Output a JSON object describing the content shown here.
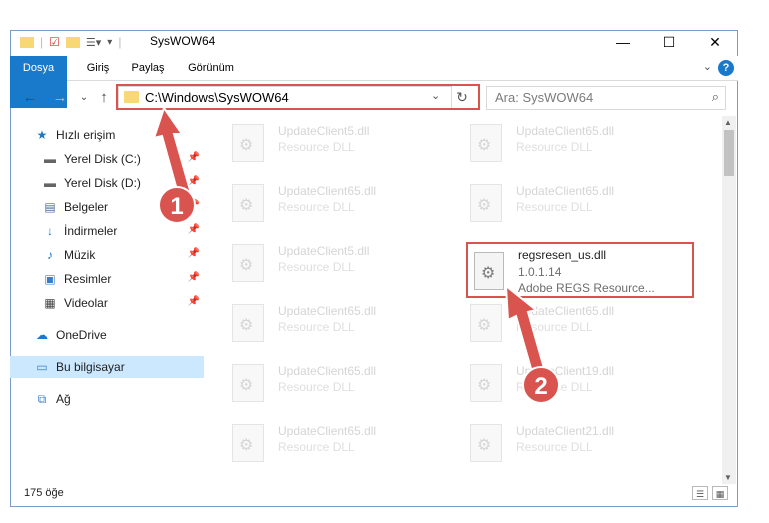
{
  "window": {
    "title": "SysWOW64",
    "controls": {
      "minimize": "—",
      "maximize": "☐",
      "close": "✕"
    }
  },
  "ribbon": {
    "tabs": [
      {
        "label": "Dosya",
        "active": true
      },
      {
        "label": "Giriş"
      },
      {
        "label": "Paylaş"
      },
      {
        "label": "Görünüm"
      }
    ],
    "help": "?"
  },
  "address": {
    "path": "C:\\Windows\\SysWOW64",
    "search_placeholder": "Ara: SysWOW64"
  },
  "sidebar": {
    "items": [
      {
        "label": "Hızlı erişim",
        "icon": "star-icon"
      },
      {
        "label": "Yerel Disk (C:)",
        "icon": "drive-icon",
        "pinned": true
      },
      {
        "label": "Yerel Disk (D:)",
        "icon": "drive-icon",
        "pinned": true
      },
      {
        "label": "Belgeler",
        "icon": "documents-icon",
        "pinned": true
      },
      {
        "label": "İndirmeler",
        "icon": "download-icon",
        "pinned": true
      },
      {
        "label": "Müzik",
        "icon": "music-icon",
        "pinned": true
      },
      {
        "label": "Resimler",
        "icon": "pictures-icon",
        "pinned": true
      },
      {
        "label": "Videolar",
        "icon": "videos-icon",
        "pinned": true
      },
      {
        "label": "OneDrive",
        "icon": "cloud-icon"
      },
      {
        "label": "Bu bilgisayar",
        "icon": "computer-icon",
        "selected": true
      },
      {
        "label": "Ağ",
        "icon": "network-icon"
      }
    ]
  },
  "files": [
    {
      "name": "UpdateClient5.dll",
      "desc": "Resource DLL"
    },
    {
      "name": "UpdateClient65.dll",
      "desc": "Resource DLL"
    },
    {
      "name": "UpdateClient65.dll",
      "desc": "Resource DLL"
    },
    {
      "name": "UpdateClient65.dll",
      "desc": "Resource DLL"
    },
    {
      "name": "UpdateClient5.dll",
      "desc": "Resource DLL"
    },
    {
      "name": "UpdateClient65.dll",
      "desc": "Resource DLL"
    },
    {
      "name": "UpdateClient65.dll",
      "desc": "Resource DLL"
    },
    {
      "name": "UpdateClient65.dll",
      "desc": "Resource DLL"
    },
    {
      "name": "UpdateClient19.dll",
      "desc": "Resource DLL"
    },
    {
      "name": "UpdateClient65.dll",
      "desc": "Resource DLL"
    },
    {
      "name": "UpdateClient21.dll",
      "desc": "Resource DLL"
    }
  ],
  "highlighted_file": {
    "name": "regsresen_us.dll",
    "version": "1.0.1.14",
    "description": "Adobe REGS Resource..."
  },
  "status": {
    "count": "175 öğe"
  },
  "callouts": {
    "one": "1",
    "two": "2"
  },
  "colors": {
    "accent": "#1979ca",
    "highlight": "#d9534f"
  }
}
